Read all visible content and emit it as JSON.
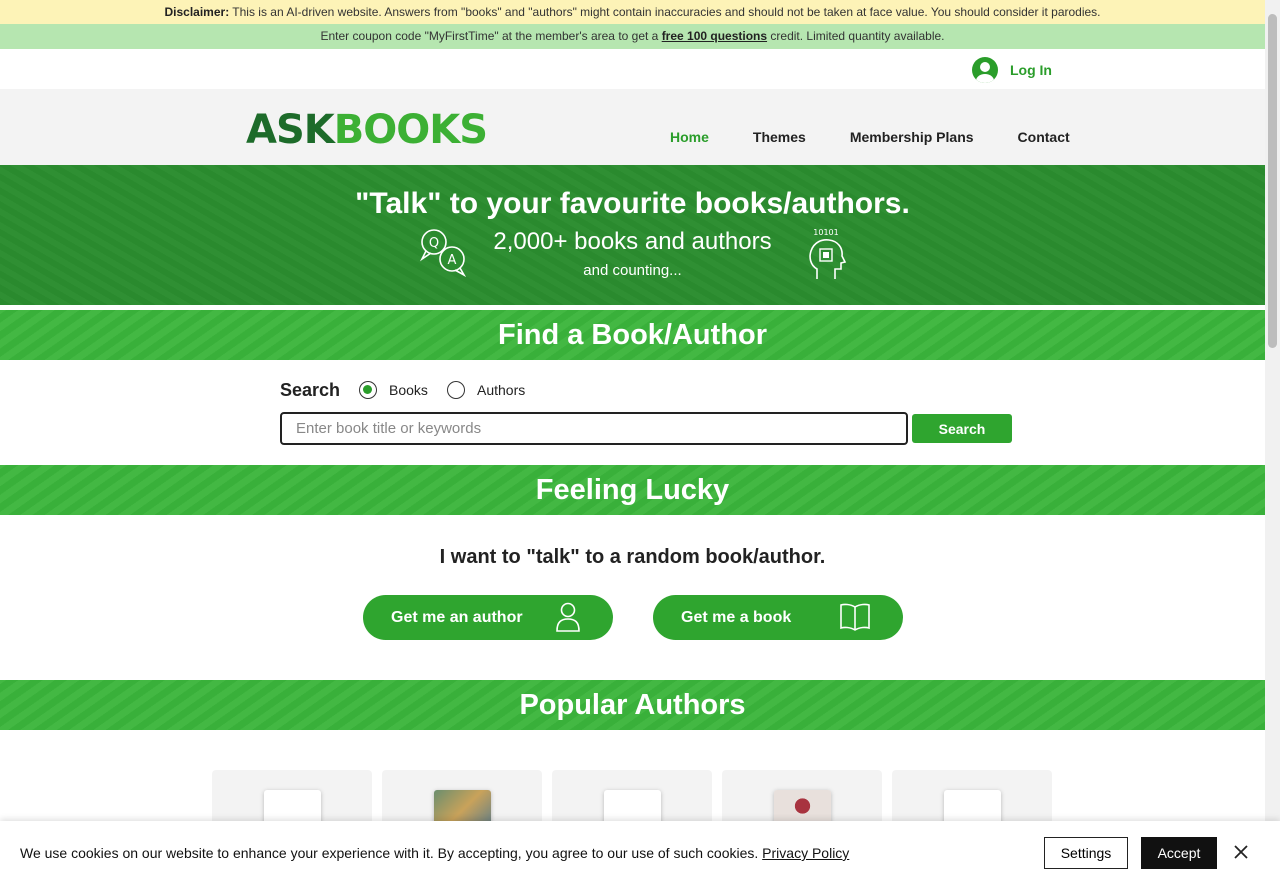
{
  "disclaimer": {
    "label": "Disclaimer:",
    "text": " This is an AI-driven website. Answers from \"books\" and \"authors\" might contain inaccuracies and should not be taken at face value. You should consider it parodies."
  },
  "coupon": {
    "before": "Enter coupon code \"MyFirstTime\" at the member's area to get a ",
    "link": "free 100 questions",
    "after": " credit. Limited quantity available."
  },
  "auth": {
    "login_label": "Log In",
    "icon": "user-avatar-icon"
  },
  "logo": {
    "part1": "ASK",
    "part2": "BOOKS"
  },
  "nav": {
    "items": [
      {
        "label": "Home",
        "active": true
      },
      {
        "label": "Themes",
        "active": false
      },
      {
        "label": "Membership Plans",
        "active": false
      },
      {
        "label": "Contact",
        "active": false
      }
    ]
  },
  "hero": {
    "title": "\"Talk\" to your favourite books/authors.",
    "count": "2,000+ books and authors",
    "counting": "and counting...",
    "binary": "10101"
  },
  "find": {
    "heading": "Find a Book/Author",
    "search_label": "Search",
    "options": [
      {
        "label": "Books",
        "selected": true
      },
      {
        "label": "Authors",
        "selected": false
      }
    ],
    "placeholder": "Enter book title or keywords",
    "button_label": "Search"
  },
  "lucky": {
    "heading": "Feeling Lucky",
    "text": "I want to \"talk\" to a random book/author.",
    "author_button": "Get me an author",
    "book_button": "Get me a book"
  },
  "popular": {
    "heading": "Popular Authors"
  },
  "cookie": {
    "message": "We use cookies on our website to enhance your experience with it. By accepting, you agree to our use of such cookies. ",
    "policy_link": "Privacy Policy",
    "settings_label": "Settings",
    "accept_label": "Accept"
  },
  "colors": {
    "brand_green": "#2fa52f",
    "dark_green": "#2a8a2e",
    "disclaimer_bg": "#fdf3b7",
    "coupon_bg": "#b6e6b0"
  }
}
